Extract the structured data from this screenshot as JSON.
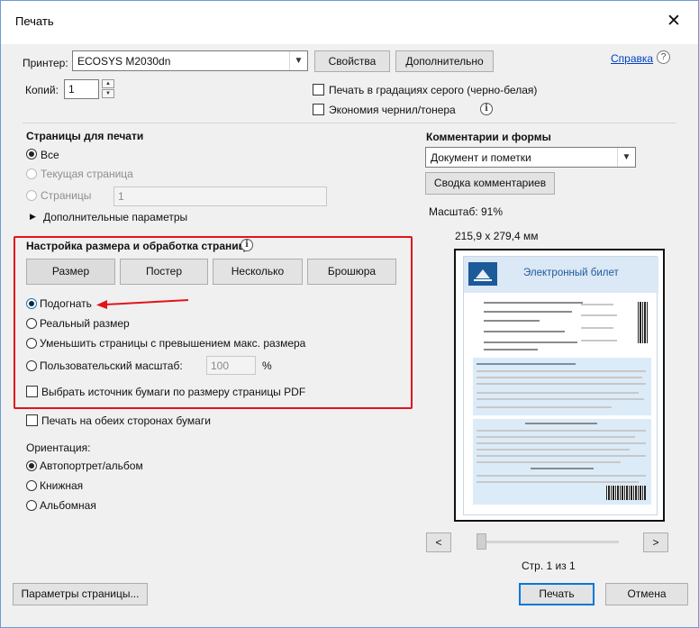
{
  "window": {
    "title": "Печать",
    "close_glyph": "✕"
  },
  "printer": {
    "label": "Принтер:",
    "selected": "ECOSYS M2030dn",
    "properties_button": "Свойства",
    "advanced_button": "Дополнительно",
    "help_link": "Справка",
    "help_icon": "question-circle-icon"
  },
  "copies": {
    "label": "Копий:",
    "value": "1"
  },
  "options": {
    "grayscale": "Печать в градациях серого (черно-белая)",
    "save_ink": "Экономия чернил/тонера"
  },
  "pages": {
    "heading": "Страницы для печати",
    "all": "Все",
    "current": "Текущая страница",
    "range": "Страницы",
    "range_value": "1",
    "more_options": "Дополнительные параметры"
  },
  "sizing": {
    "heading": "Настройка размера и обработка страниц",
    "tabs": [
      "Размер",
      "Постер",
      "Несколько",
      "Брошюра"
    ],
    "fit": "Подогнать",
    "actual_size": "Реальный размер",
    "shrink": "Уменьшить страницы с превышением макс. размера",
    "custom_scale": "Пользовательский масштаб:",
    "custom_scale_value": "100",
    "percent": "%",
    "paper_source": "Выбрать источник бумаги по размеру страницы PDF",
    "highlight_color": "#e2141b"
  },
  "duplex": {
    "label": "Печать на обеих сторонах бумаги"
  },
  "orientation": {
    "heading": "Ориентация:",
    "auto": "Автопортрет/альбом",
    "portrait": "Книжная",
    "landscape": "Альбомная"
  },
  "comments": {
    "heading": "Комментарии и формы",
    "selected": "Документ и пометки",
    "summary_button": "Сводка комментариев"
  },
  "preview": {
    "scale": "Масштаб:  91%",
    "size": "215,9 x 279,4 мм",
    "ticket_title": "Электронный билет",
    "prev_glyph": "<",
    "next_glyph": ">",
    "page_indicator": "Стр. 1 из 1"
  },
  "footer": {
    "page_setup_button": "Параметры страницы...",
    "print_button": "Печать",
    "cancel_button": "Отмена"
  },
  "colors": {
    "accent": "#0078d7",
    "link": "#0040c0",
    "ticket_blue": "#1d5a9a"
  }
}
